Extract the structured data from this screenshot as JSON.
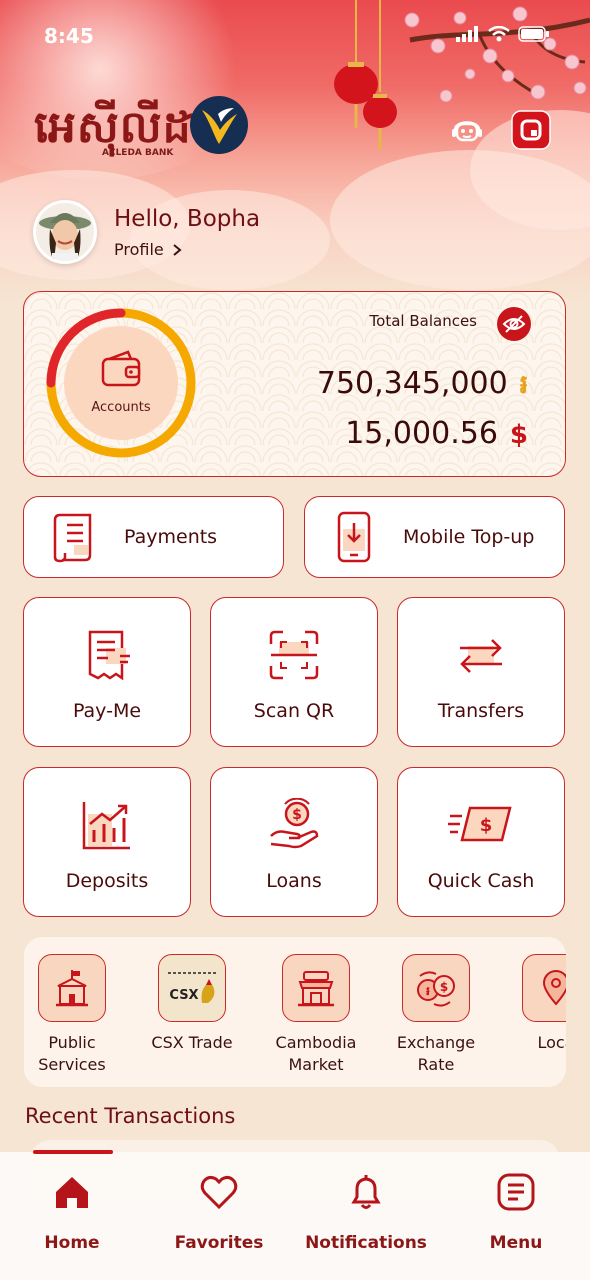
{
  "status_bar": {
    "time": "8:45"
  },
  "brand": {
    "logo_khmer": "អេស៊ីលីដា",
    "logo_sub": "ACLEDA BANK"
  },
  "header": {
    "greeting": "Hello, Bopha",
    "profile_link": "Profile"
  },
  "balance": {
    "label": "Total Balances",
    "accounts_label": "Accounts",
    "khr_amount": "750,345,000",
    "khr_symbol": "៛",
    "usd_amount": "15,000.56",
    "usd_symbol": "$"
  },
  "quick_actions": [
    {
      "label": "Payments",
      "icon": "receipt-scroll-icon"
    },
    {
      "label": "Mobile Top-up",
      "icon": "phone-download-icon"
    }
  ],
  "tiles": [
    {
      "label": "Pay-Me",
      "icon": "invoice-icon"
    },
    {
      "label": "Scan QR",
      "icon": "scan-qr-icon"
    },
    {
      "label": "Transfers",
      "icon": "transfer-arrows-icon"
    },
    {
      "label": "Deposits",
      "icon": "growth-chart-icon"
    },
    {
      "label": "Loans",
      "icon": "hand-coin-icon"
    },
    {
      "label": "Quick Cash",
      "icon": "fast-cash-icon"
    }
  ],
  "shortcuts": [
    {
      "label": "Public Services",
      "icon": "government-building-icon"
    },
    {
      "label": "CSX Trade",
      "icon": "csx-logo-icon",
      "logo_text": "CSX"
    },
    {
      "label": "Cambodia Market",
      "icon": "market-stall-icon"
    },
    {
      "label": "Exchange Rate",
      "icon": "currency-exchange-icon"
    },
    {
      "label": "Loca",
      "icon": "location-pin-icon"
    }
  ],
  "recent": {
    "title": "Recent Transactions"
  },
  "bottom_nav": [
    {
      "label": "Home",
      "icon": "home-icon",
      "active": true
    },
    {
      "label": "Favorites",
      "icon": "heart-icon",
      "active": false
    },
    {
      "label": "Notifications",
      "icon": "bell-icon",
      "active": false
    },
    {
      "label": "Menu",
      "icon": "menu-icon",
      "active": false
    }
  ],
  "colors": {
    "primary_red": "#c8151b",
    "accent_gold": "#f5a800",
    "background": "#f6e5d2"
  }
}
